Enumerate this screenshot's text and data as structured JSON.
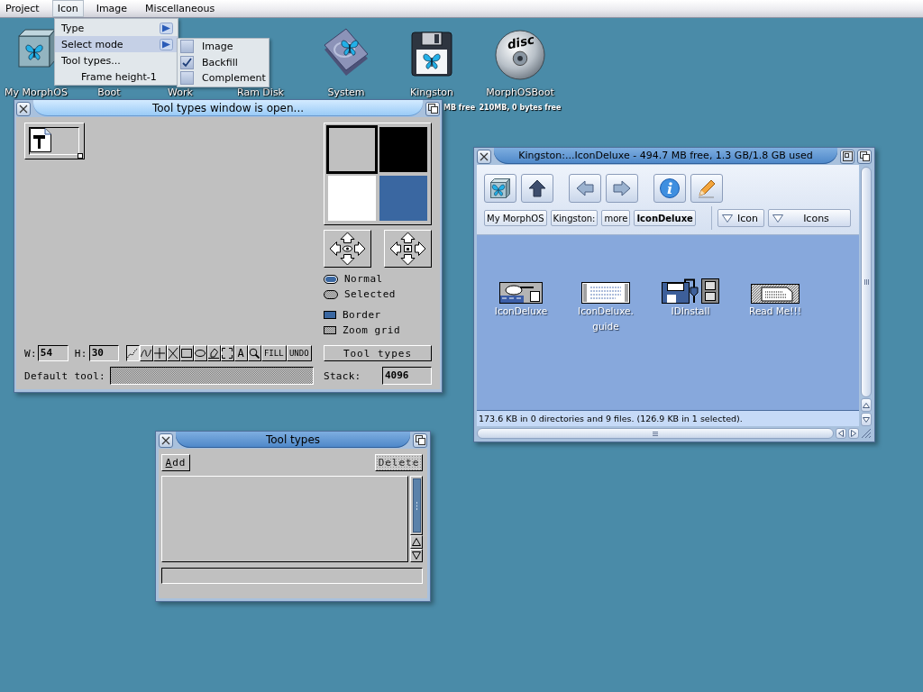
{
  "menu_bar": {
    "items": [
      {
        "label": "Project",
        "selected": false
      },
      {
        "label": "Icon",
        "selected": true
      },
      {
        "label": "Image",
        "selected": false
      },
      {
        "label": "Miscellaneous",
        "selected": false
      }
    ]
  },
  "menu": {
    "items": [
      {
        "label": "Type",
        "kind": "submenu",
        "selected": false
      },
      {
        "label": "Select mode",
        "kind": "submenu",
        "selected": true
      },
      {
        "label": "Tool types...",
        "kind": "item",
        "selected": false
      },
      {
        "label": "Frame height-1",
        "kind": "toggle",
        "checked": false,
        "selected": false
      }
    ]
  },
  "submenu": {
    "items": [
      {
        "label": "Image",
        "checked": false
      },
      {
        "label": "Backfill",
        "checked": true
      },
      {
        "label": "Complement",
        "checked": false
      }
    ]
  },
  "desktop_icons": [
    {
      "label": "My MorphOS"
    },
    {
      "label": "Boot"
    },
    {
      "label": "Work"
    },
    {
      "label": "Ram Disk"
    },
    {
      "label": "System"
    },
    {
      "label": "Kingston",
      "subtitle": "MB free"
    },
    {
      "label": "MorphOSBoot",
      "subtitle": "210MB, 0 bytes free",
      "logo": "disc"
    }
  ],
  "editor_window": {
    "title": "Tool types window is open...",
    "active": true,
    "palette": [
      {
        "color": "#c0c0c0",
        "selected": true
      },
      {
        "color": "#000000",
        "selected": false
      },
      {
        "color": "#ffffff",
        "selected": false
      },
      {
        "color": "#3a67a1",
        "selected": false
      }
    ],
    "image_modes": [
      {
        "label": "Normal",
        "selected": true
      },
      {
        "label": "Selected",
        "selected": false
      }
    ],
    "options": [
      {
        "label": "Border",
        "checked": true
      },
      {
        "label": "Zoom grid",
        "checked": false
      }
    ],
    "width": {
      "label": "W:",
      "value": "54"
    },
    "height": {
      "label": "H:",
      "value": "30"
    },
    "tools": [
      {
        "kind": "icon",
        "selected": true
      },
      {
        "kind": "icon",
        "selected": false
      },
      {
        "kind": "icon",
        "selected": false
      },
      {
        "kind": "icon",
        "selected": false
      },
      {
        "kind": "icon",
        "selected": false
      },
      {
        "kind": "icon",
        "selected": false
      },
      {
        "kind": "icon",
        "selected": false
      },
      {
        "kind": "icon",
        "selected": false
      },
      {
        "kind": "text",
        "label": "A",
        "selected": false
      },
      {
        "kind": "icon",
        "selected": false
      },
      {
        "kind": "text",
        "label": "FILL",
        "selected": false
      },
      {
        "kind": "text",
        "label": "UNDO",
        "selected": false
      }
    ],
    "tool_types_button": "Tool types",
    "default_tool": {
      "label": "Default tool:",
      "disabled": true
    },
    "stack": {
      "label": "Stack:",
      "value": "4096"
    }
  },
  "drawer_window": {
    "title": "Kingston:...IconDeluxe - 494.7 MB free, 1.3 GB/1.8 GB used",
    "active": false,
    "path": [
      {
        "label": "My MorphOS",
        "selected": false
      },
      {
        "label": "Kingston:",
        "selected": false
      },
      {
        "label": "more",
        "selected": false
      },
      {
        "label": "IconDeluxe",
        "selected": true
      }
    ],
    "view_menus": [
      {
        "label": "Icon"
      },
      {
        "label": "Icons"
      }
    ],
    "files": [
      {
        "label": "IconDeluxe"
      },
      {
        "label": "IconDeluxe.\nguide"
      },
      {
        "label": "IDInstall"
      },
      {
        "label": "Read Me!!!"
      }
    ],
    "status": "173.6 KB in 0 directories and 9 files. (126.9 KB in 1 selected)."
  },
  "tool_types_window": {
    "title": "Tool types",
    "active": false,
    "add_button": {
      "label": "Add",
      "disabled": false
    },
    "delete_button": {
      "label": "Delete",
      "disabled": true
    }
  }
}
